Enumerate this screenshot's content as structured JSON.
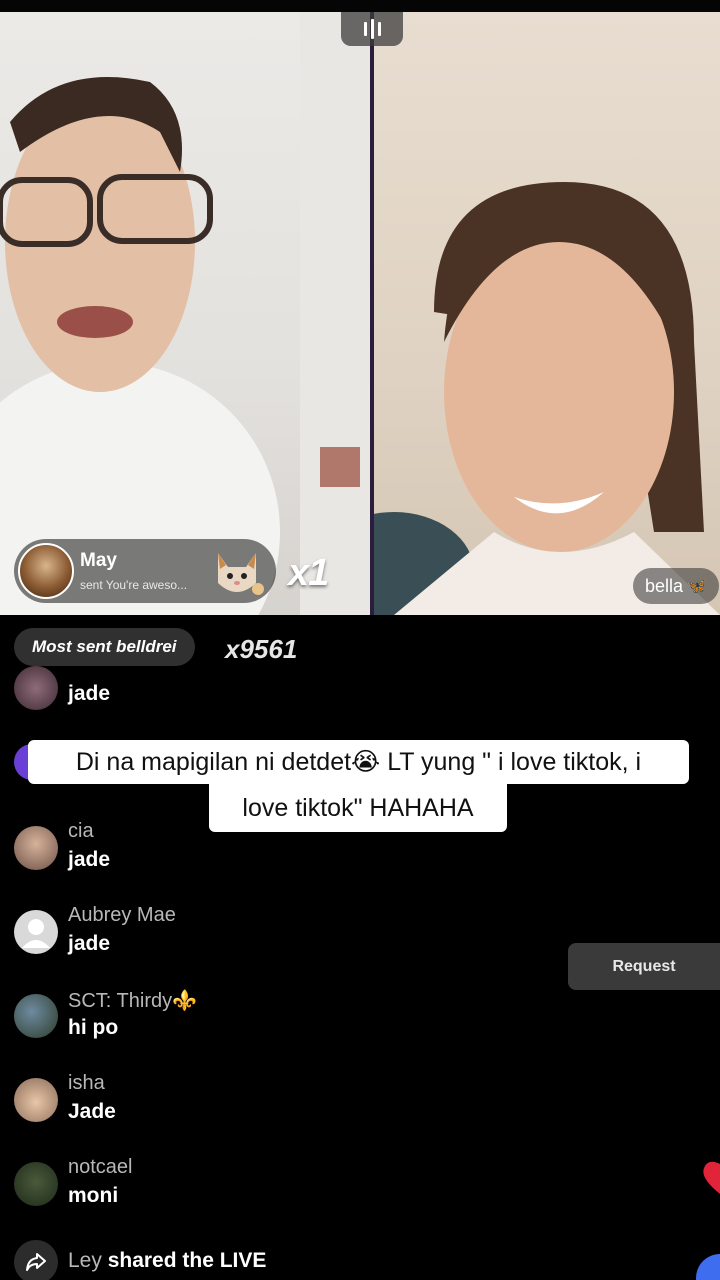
{
  "left_video": {
    "gift": {
      "sender_name": "May",
      "message": "sent You're aweso...",
      "count": "x1"
    }
  },
  "right_video": {
    "host_name": "bella"
  },
  "most_sent": {
    "label": "Most sent belldrei",
    "count": "x9561"
  },
  "caption": {
    "line1": "Di na mapigilan ni detdet😭 LT yung \" i love tiktok, i",
    "line2": "love tiktok\" HAHAHA"
  },
  "comments": [
    {
      "user": "",
      "text": "jade"
    },
    {
      "user": "cia",
      "text": "jade"
    },
    {
      "user": "Aubrey Mae",
      "text": "jade"
    },
    {
      "user": "SCT: Thirdy⚜️",
      "text": "hi po"
    },
    {
      "user": "isha",
      "text": "Jade"
    },
    {
      "user": "notcael",
      "text": "moni"
    }
  ],
  "share": {
    "user": "Ley",
    "action": " shared the LIVE"
  },
  "request_button": "Request",
  "colors": {
    "accent_purple": "#6a3fd6",
    "heart_red": "#e0243a",
    "fab_blue": "#3f6df0"
  }
}
